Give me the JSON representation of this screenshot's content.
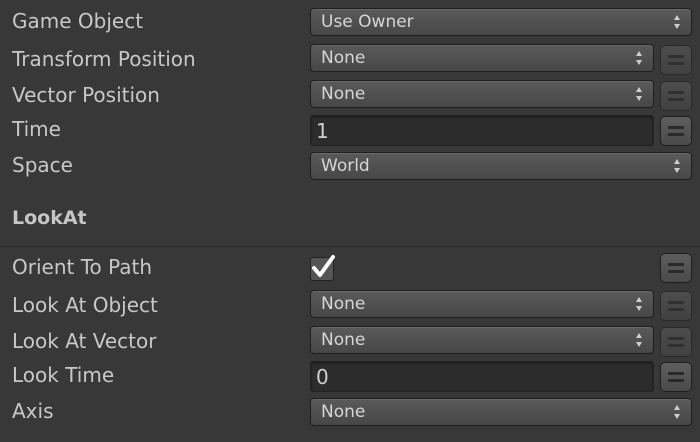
{
  "fields": {
    "game_object": {
      "label": "Game Object",
      "value": "Use Owner"
    },
    "transform_position": {
      "label": "Transform Position",
      "value": "None"
    },
    "vector_position": {
      "label": "Vector Position",
      "value": "None"
    },
    "time": {
      "label": "Time",
      "value": "1"
    },
    "space": {
      "label": "Space",
      "value": "World"
    }
  },
  "lookat": {
    "title": "LookAt",
    "orient_to_path": {
      "label": "Orient To Path",
      "checked": true
    },
    "look_at_object": {
      "label": "Look At Object",
      "value": "None"
    },
    "look_at_vector": {
      "label": "Look At Vector",
      "value": "None"
    },
    "look_time": {
      "label": "Look Time",
      "value": "0"
    },
    "axis": {
      "label": "Axis",
      "value": "None"
    }
  },
  "icons": {
    "dropdown_arrow": "up-down-arrows-icon",
    "variable_toggle": "equals-icon",
    "checkmark": "checkmark-icon"
  },
  "colors": {
    "background": "#383838",
    "text": "#c8c8c8",
    "field": "#2c2c2c",
    "dropdown": "#4f4f4f"
  }
}
